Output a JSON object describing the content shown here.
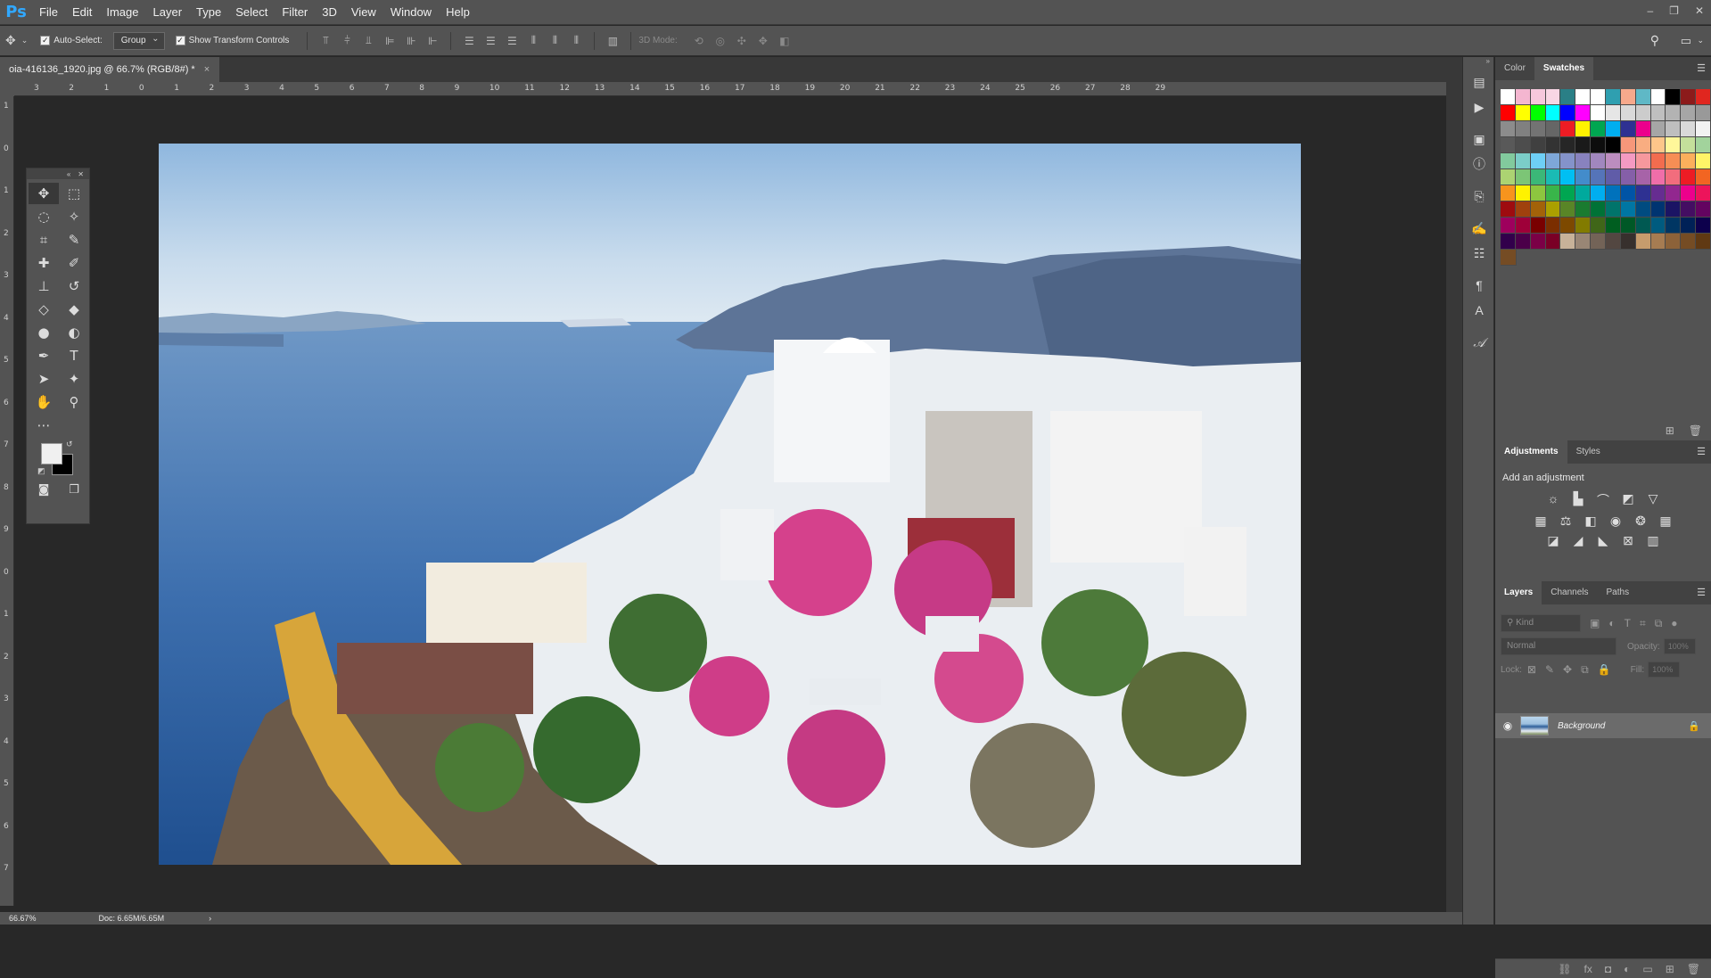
{
  "app": {
    "logo": "Ps"
  },
  "menu": [
    "File",
    "Edit",
    "Image",
    "Layer",
    "Type",
    "Select",
    "Filter",
    "3D",
    "View",
    "Window",
    "Help"
  ],
  "window_controls": {
    "minimize": "‒",
    "restore": "❐",
    "close": "✕"
  },
  "options": {
    "auto_select_label": "Auto-Select:",
    "auto_select_value": "Group",
    "show_transform_label": "Show Transform Controls",
    "mode_3d_label": "3D Mode:"
  },
  "document": {
    "tab_title": "oia-416136_1920.jpg @ 66.7% (RGB/8#) *",
    "close": "×"
  },
  "ruler_h": [
    "3",
    "2",
    "1",
    "0",
    "1",
    "2",
    "3",
    "4",
    "5",
    "6",
    "7",
    "8",
    "9",
    "10",
    "11",
    "12",
    "13",
    "14",
    "15",
    "16",
    "17",
    "18",
    "19",
    "20",
    "21",
    "22",
    "23",
    "24",
    "25",
    "26",
    "27",
    "28",
    "29"
  ],
  "ruler_v": [
    "1",
    "0",
    "1",
    "2",
    "3",
    "4",
    "5",
    "6",
    "7",
    "8",
    "9",
    "0",
    "1",
    "2",
    "3",
    "4",
    "5",
    "6",
    "7"
  ],
  "status": {
    "zoom": "66.67%",
    "doc": "Doc: 6.65M/6.65M",
    "arrow": "›"
  },
  "panels": {
    "color_tab": "Color",
    "swatches_tab": "Swatches",
    "adjustments_tab": "Adjustments",
    "styles_tab": "Styles",
    "add_adjustment": "Add an adjustment",
    "layers_tab": "Layers",
    "channels_tab": "Channels",
    "paths_tab": "Paths",
    "kind_placeholder": "⚲ Kind",
    "blend_mode": "Normal",
    "opacity_label": "Opacity:",
    "opacity_value": "100%",
    "lock_label": "Lock:",
    "fill_label": "Fill:",
    "fill_value": "100%",
    "layer_name": "Background"
  },
  "swatch_colors": [
    [
      "#ffffff",
      "#f4b6d0",
      "#f6c8dc",
      "#f8d6e4",
      "#2a7f86",
      "#ffffff",
      "#ffffff",
      "#2f9fb0",
      "#f7a98c",
      "#5fb8c6",
      "#ffffff",
      "#000000",
      "#8c1b1b",
      "#e0261f"
    ],
    [
      "#ff0000",
      "#ffff00",
      "#00ff00",
      "#00ffff",
      "#0000ff",
      "#ff00ff",
      "#ffffff",
      "#e6e6e6",
      "#d9d9d9",
      "#cccccc",
      "#bfbfbf",
      "#b3b3b3",
      "#a6a6a6",
      "#999999"
    ],
    [
      "#8c8c8c",
      "#808080",
      "#737373",
      "#666666",
      "#ed1c24",
      "#fff200",
      "#00a651",
      "#00aeef",
      "#2e3192",
      "#ec008c",
      "#a6a6a6",
      "#bfbfbf",
      "#d9d9d9",
      "#f2f2f2"
    ],
    [
      "#595959",
      "#4d4d4d",
      "#404040",
      "#333333",
      "#262626",
      "#1a1a1a",
      "#0d0d0d",
      "#000000",
      "#f7977a",
      "#f9ad81",
      "#fdc68a",
      "#fff79a",
      "#c4df9b",
      "#a2d39c"
    ],
    [
      "#82ca9d",
      "#7bcdc8",
      "#6ecff6",
      "#7ea7d8",
      "#8493ca",
      "#8882be",
      "#a187be",
      "#bc8dbf",
      "#f49ac2",
      "#f6989d",
      "#f26c4f",
      "#f68e55",
      "#fbaf5c",
      "#fff467"
    ],
    [
      "#acd372",
      "#7cc576",
      "#3bb878",
      "#1abbb4",
      "#00bff3",
      "#438ccb",
      "#5574b9",
      "#605ca8",
      "#855fa8",
      "#a763a8",
      "#f06ea9",
      "#f26d7d",
      "#ed1c24",
      "#f26522"
    ],
    [
      "#f7941d",
      "#fff200",
      "#8dc63f",
      "#39b54a",
      "#00a651",
      "#00a99d",
      "#00aeef",
      "#0072bc",
      "#0054a6",
      "#2e3192",
      "#662d91",
      "#92278f",
      "#ec008c",
      "#ed145b"
    ],
    [
      "#9e0b0f",
      "#a0410d",
      "#a36209",
      "#aba000",
      "#598527",
      "#1a7b30",
      "#007236",
      "#00746b",
      "#0076a3",
      "#004b80",
      "#003471",
      "#1b1464",
      "#440e62",
      "#630460"
    ],
    [
      "#9e005d",
      "#9e0039",
      "#790000",
      "#7b2e00",
      "#7d4900",
      "#827b00",
      "#406618",
      "#005e20",
      "#005826",
      "#005952",
      "#005b7f",
      "#003663",
      "#002157",
      "#0d004c"
    ],
    [
      "#32004b",
      "#4b0049",
      "#7b0046",
      "#7a0026",
      "#c7b299",
      "#998675",
      "#736357",
      "#534741",
      "#37302d",
      "#c69c6d",
      "#a67c52",
      "#8c6239",
      "#754c24",
      "#603913"
    ],
    [
      "#754c24"
    ]
  ],
  "layer_thumb_desc": "thumbnail"
}
